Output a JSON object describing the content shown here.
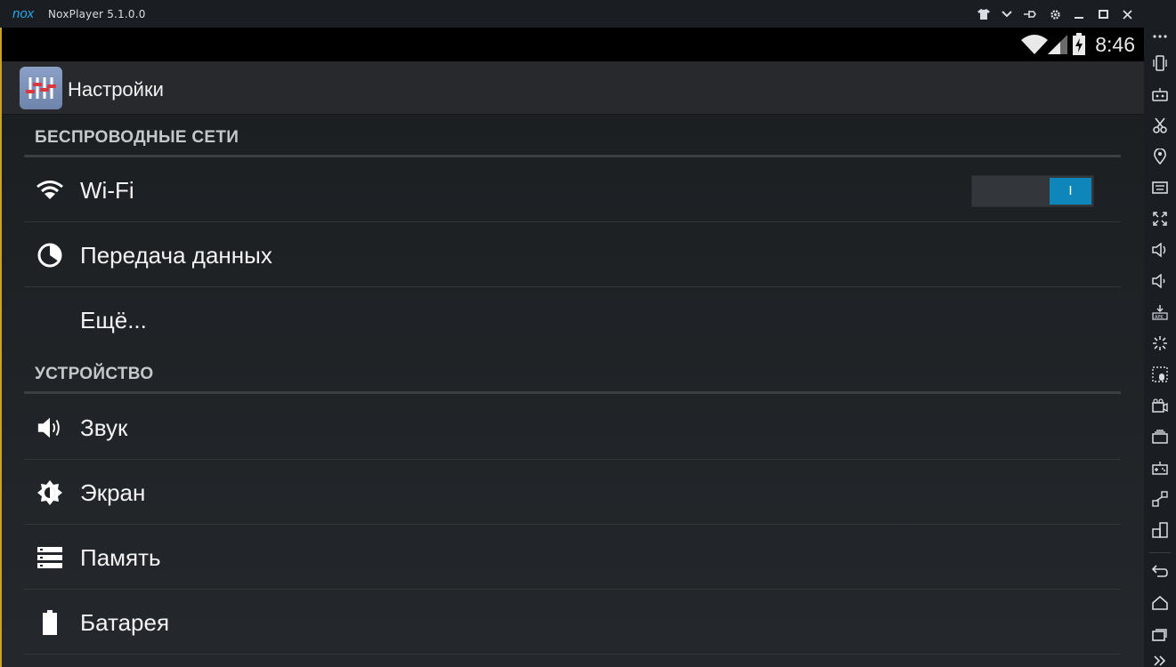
{
  "window": {
    "title": "NoxPlayer 5.1.0.0",
    "logo_text": "nox",
    "controls": [
      "shirt-icon",
      "chevron-down-icon",
      "pin-icon",
      "gear-icon",
      "minimize-icon",
      "maximize-icon",
      "close-icon"
    ]
  },
  "statusbar": {
    "time": "8:46",
    "icons": [
      "wifi-icon",
      "signal-icon",
      "battery-charging-icon"
    ]
  },
  "actionbar": {
    "title": "Настройки"
  },
  "settings": {
    "wireless_header": "БЕСПРОВОДНЫЕ СЕТИ",
    "device_header": "УСТРОЙСТВО",
    "wifi_label": "Wi-Fi",
    "wifi_toggle_on": true,
    "wifi_toggle_text": "I",
    "data_label": "Передача данных",
    "more_label": "Ещё...",
    "sound_label": "Звук",
    "screen_label": "Экран",
    "memory_label": "Память",
    "battery_label": "Батарея"
  },
  "colors": {
    "accent": "#0f86b9",
    "titlebar_bg": "#1a1d22",
    "android_bg": "#1f2225",
    "frame_border": "#c9a227"
  },
  "sidebar": {
    "icons": [
      "more-icon",
      "shake-icon",
      "robot-icon",
      "scissors-icon",
      "location-icon",
      "keyboard-icon",
      "fullscreen-icon",
      "volume-up-icon",
      "volume-down-icon",
      "apk-icon",
      "loading-icon",
      "macro-icon",
      "video-icon",
      "multi-instance-icon",
      "gamepad-icon",
      "sync-icon",
      "multi-window-icon",
      "back-icon",
      "home-icon",
      "recents-icon",
      "expand-icon"
    ]
  }
}
